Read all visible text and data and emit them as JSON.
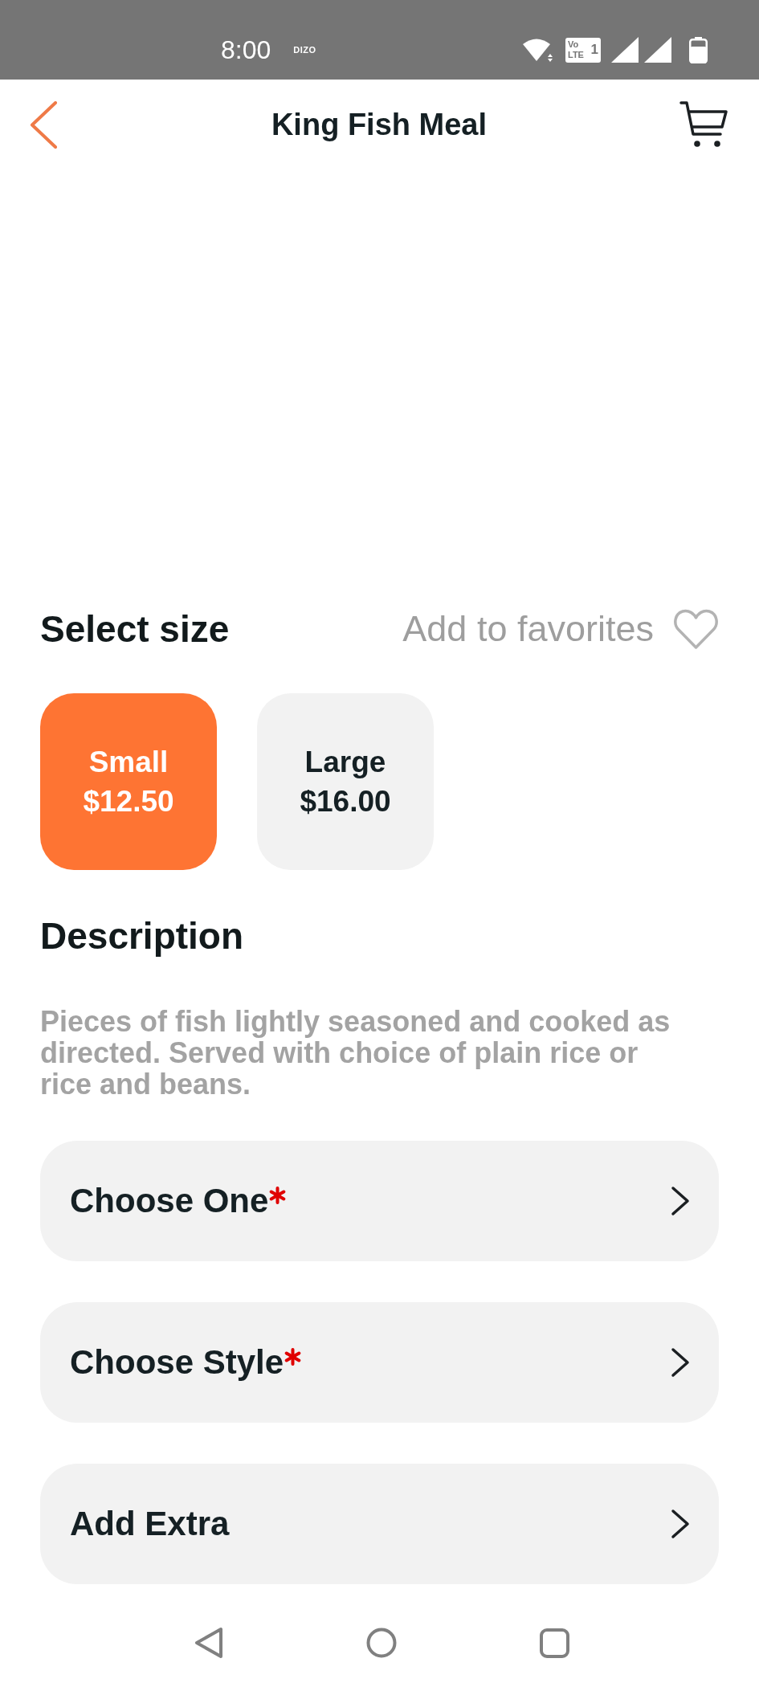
{
  "status_bar": {
    "time": "8:00",
    "app_label": "DIZO",
    "volte_badge": {
      "top": "Vo",
      "bottom": "LTE",
      "sim": "1"
    }
  },
  "header": {
    "title": "King Fish Meal"
  },
  "size_section": {
    "title": "Select size",
    "favorite": {
      "label": "Add to favorites",
      "favorited": false
    },
    "options": [
      {
        "name": "Small",
        "price": "$12.50",
        "selected": true
      },
      {
        "name": "Large",
        "price": "$16.00",
        "selected": false
      }
    ]
  },
  "description": {
    "title": "Description",
    "text": "Pieces of fish lightly seasoned and cooked as directed. Served with choice of plain rice or rice and beans."
  },
  "choices": [
    {
      "label": "Choose One",
      "required": true
    },
    {
      "label": "Choose Style",
      "required": true
    },
    {
      "label": "Add Extra",
      "required": false
    }
  ]
}
